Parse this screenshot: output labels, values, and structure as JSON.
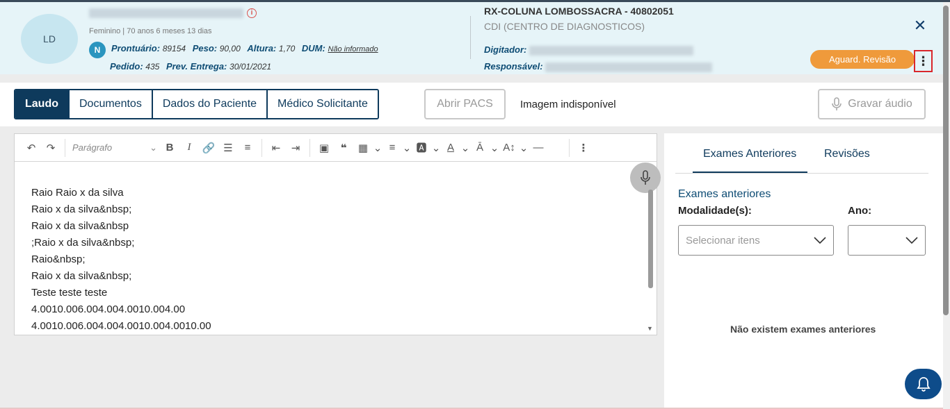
{
  "patient": {
    "initials": "LD",
    "demographics": "Feminino | 70 anos 6 meses 13 dias",
    "badge": "N",
    "prontuario_label": "Prontuário:",
    "prontuario_value": "89154",
    "peso_label": "Peso:",
    "peso_value": "90,00",
    "altura_label": "Altura:",
    "altura_value": "1,70",
    "dum_label": "DUM:",
    "dum_value": "Não informado",
    "pedido_label": "Pedido:",
    "pedido_value": "435",
    "entrega_label": "Prev. Entrega:",
    "entrega_value": "30/01/2021"
  },
  "exam": {
    "title": "RX-COLUNA LOMBOSSACRA - 40802051",
    "unit": "CDI (CENTRO DE DIAGNOSTICOS)",
    "digitador_label": "Digitador:",
    "responsavel_label": "Responsável:"
  },
  "status": {
    "label": "Aguard. Revisão",
    "color": "#ef9a3b"
  },
  "tabs": [
    {
      "label": "Laudo"
    },
    {
      "label": "Documentos"
    },
    {
      "label": "Dados do Paciente"
    },
    {
      "label": "Médico Solicitante"
    }
  ],
  "actions": {
    "pacs": "Abrir PACS",
    "image_status": "Imagem indisponível",
    "audio": "Gravar áudio"
  },
  "editor": {
    "paragraph_style": "Parágrafo",
    "lines": [
      "Raio Raio x da silva",
      "Raio x da silva&nbsp;",
      "Raio x da silva&nbsp",
      ";Raio x da silva&nbsp;",
      "Raio&nbsp;",
      "Raio x da silva&nbsp;",
      "Teste teste teste",
      "4.0010.006.004.004.0010.004.00",
      "4.0010.006.004.004.0010.004.0010.00"
    ]
  },
  "right_panel": {
    "tabs": [
      "Exames Anteriores",
      "Revisões"
    ],
    "section_title": "Exames anteriores",
    "modalidade_label": "Modalidade(s):",
    "modalidade_placeholder": "Selecionar itens",
    "ano_label": "Ano:",
    "empty_message": "Não existem exames anteriores"
  },
  "icons": [
    "info-icon",
    "close-icon",
    "more-vertical-icon",
    "microphone-icon",
    "chevron-down-icon",
    "bell-icon"
  ],
  "colors": {
    "primary": "#0e3a5c",
    "accent": "#2a95bf",
    "header_bg": "#e6f4f8"
  }
}
